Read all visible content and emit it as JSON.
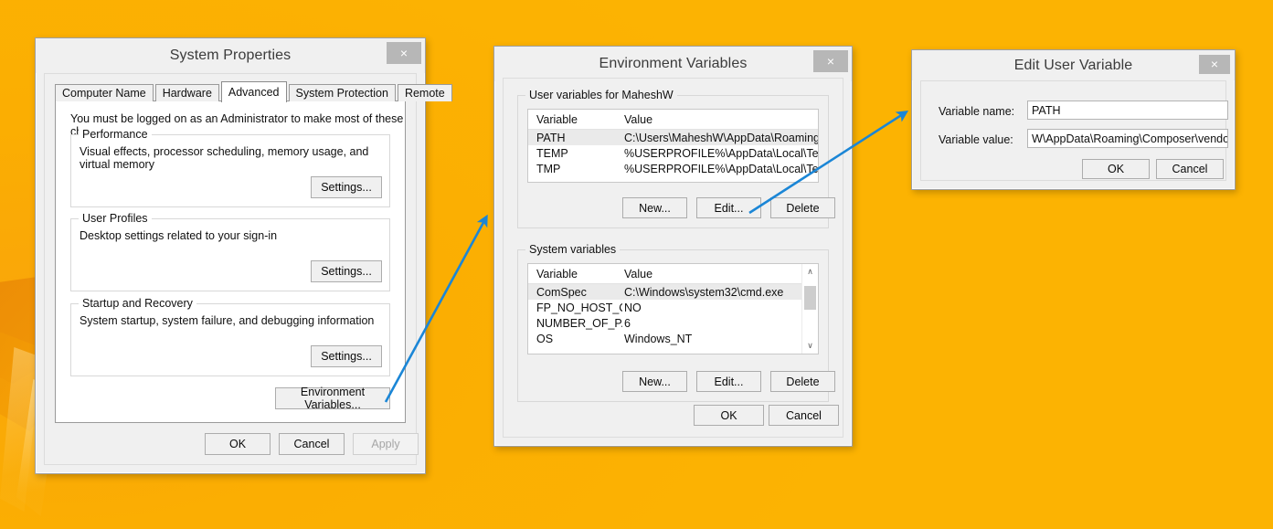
{
  "desktop": {
    "background_color": "#fbb102",
    "accent_arrow_color": "#1b86d6"
  },
  "system_properties": {
    "title": "System Properties",
    "close_label": "×",
    "tabs": [
      {
        "label": "Computer Name",
        "active": false
      },
      {
        "label": "Hardware",
        "active": false
      },
      {
        "label": "Advanced",
        "active": true
      },
      {
        "label": "System Protection",
        "active": false
      },
      {
        "label": "Remote",
        "active": false
      }
    ],
    "admin_note": "You must be logged on as an Administrator to make most of these changes.",
    "groups": [
      {
        "title": "Performance",
        "description": "Visual effects, processor scheduling, memory usage, and virtual memory",
        "button": "Settings..."
      },
      {
        "title": "User Profiles",
        "description": "Desktop settings related to your sign-in",
        "button": "Settings..."
      },
      {
        "title": "Startup and Recovery",
        "description": "System startup, system failure, and debugging information",
        "button": "Settings..."
      }
    ],
    "environment_variables_button": "Environment Variables...",
    "footer": {
      "ok": "OK",
      "cancel": "Cancel",
      "apply": "Apply",
      "apply_disabled": true
    }
  },
  "environment_variables": {
    "title": "Environment Variables",
    "close_label": "×",
    "user_section": {
      "title": "User variables for MaheshW",
      "columns": [
        "Variable",
        "Value"
      ],
      "rows": [
        {
          "variable": "PATH",
          "value": "C:\\Users\\MaheshW\\AppData\\Roaming\\...",
          "selected": true
        },
        {
          "variable": "TEMP",
          "value": "%USERPROFILE%\\AppData\\Local\\Temp",
          "selected": false
        },
        {
          "variable": "TMP",
          "value": "%USERPROFILE%\\AppData\\Local\\Temp",
          "selected": false
        }
      ],
      "buttons": {
        "new": "New...",
        "edit": "Edit...",
        "delete": "Delete"
      }
    },
    "system_section": {
      "title": "System variables",
      "columns": [
        "Variable",
        "Value"
      ],
      "rows": [
        {
          "variable": "ComSpec",
          "value": "C:\\Windows\\system32\\cmd.exe",
          "selected": true
        },
        {
          "variable": "FP_NO_HOST_C...",
          "value": "NO",
          "selected": false
        },
        {
          "variable": "NUMBER_OF_P...",
          "value": "6",
          "selected": false
        },
        {
          "variable": "OS",
          "value": "Windows_NT",
          "selected": false
        }
      ],
      "buttons": {
        "new": "New...",
        "edit": "Edit...",
        "delete": "Delete"
      },
      "scrollbar": {
        "up": "∧",
        "down": "∨"
      }
    },
    "footer": {
      "ok": "OK",
      "cancel": "Cancel"
    }
  },
  "edit_user_variable": {
    "title": "Edit User Variable",
    "close_label": "×",
    "name_label": "Variable name:",
    "name_value": "PATH",
    "value_label": "Variable value:",
    "value_value": "W\\AppData\\Roaming\\Composer\\vendor\\bin",
    "footer": {
      "ok": "OK",
      "cancel": "Cancel"
    }
  }
}
